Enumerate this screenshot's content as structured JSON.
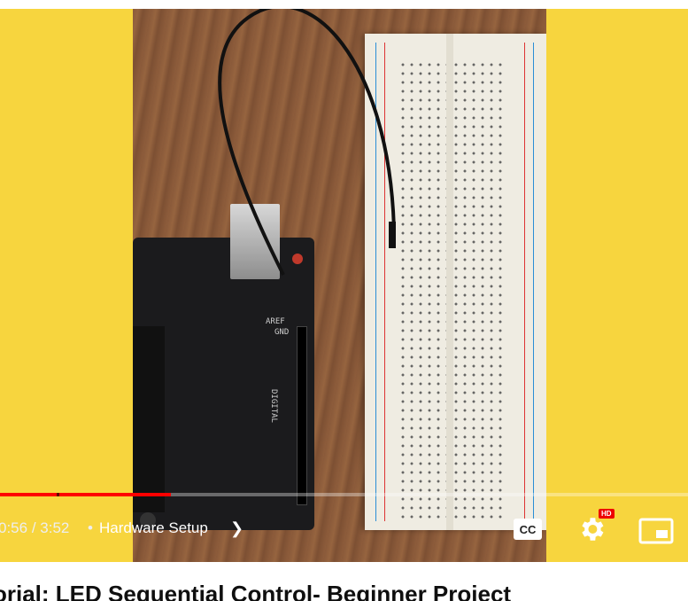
{
  "video": {
    "background_color": "#f7d53e",
    "scene": "arduino-board-and-breadboard",
    "progress_fraction": 0.248
  },
  "controls": {
    "current_time": "0:56",
    "separator": " / ",
    "duration": "3:52",
    "chapter_dot": "•",
    "chapter": "Hardware Setup",
    "chapter_chevron": "❯",
    "cc_label": "CC",
    "hd_badge": "HD",
    "icons": [
      "cc-icon",
      "settings-gear-icon",
      "miniplayer-icon"
    ]
  },
  "title": "orial: LED Sequential Control- Beginner Project"
}
